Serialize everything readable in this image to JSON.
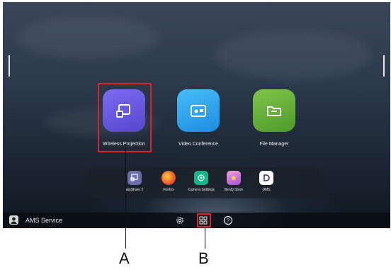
{
  "apps": {
    "wireless_projection": "Wireless Projection",
    "video_conference": "Video Conference",
    "file_manager": "File Manager"
  },
  "dock": {
    "items": [
      {
        "label": "ataShare 2",
        "icon": "datashare-icon"
      },
      {
        "label": "Firefox",
        "icon": "firefox-icon"
      },
      {
        "label": "Camera Settings",
        "icon": "camera-icon"
      },
      {
        "label": "BenQ Store",
        "icon": "store-icon"
      },
      {
        "label": "DMS",
        "icon": "dms-icon"
      }
    ]
  },
  "taskbar": {
    "user_label": "AMS Service",
    "icons": [
      "settings-icon",
      "apps-grid-icon",
      "help-icon"
    ]
  },
  "callouts": {
    "a": "A",
    "b": "B"
  },
  "colors": {
    "highlight": "#d9262b",
    "wireless": "#6a5be0",
    "video": "#2aa3f0",
    "file": "#68b338"
  }
}
